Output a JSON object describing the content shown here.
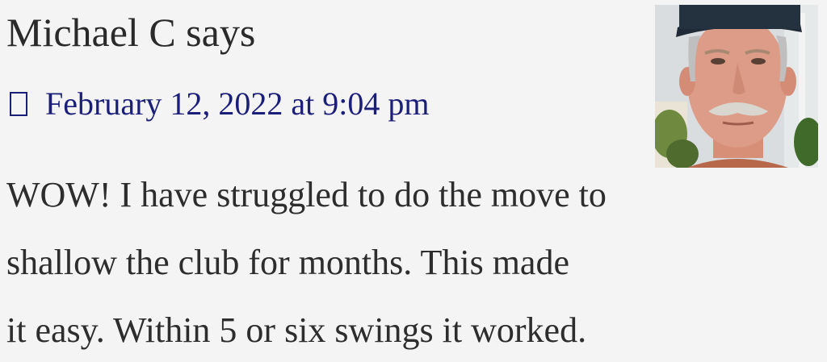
{
  "comment": {
    "author": "Michael C",
    "says": "says",
    "date": "February 12, 2022 at 9:04 pm",
    "icon": "clock-icon",
    "body_lines": [
      "WOW! I have struggled to do the move to",
      "shallow the club for months. This made",
      "it easy. Within 5 or six swings it worked."
    ]
  },
  "colors": {
    "background": "#f4f4f5",
    "link": "#1c1f7a",
    "text": "#2d2d2d"
  }
}
